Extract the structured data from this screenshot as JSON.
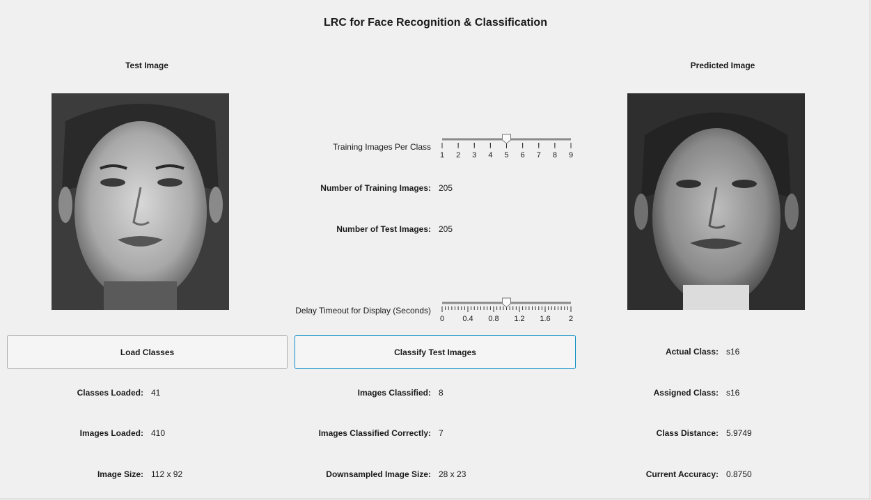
{
  "title": "LRC for Face Recognition & Classification",
  "test_panel": {
    "title": "Test Image"
  },
  "predicted_panel": {
    "title": "Predicted Image"
  },
  "sliders": {
    "training": {
      "label": "Training Images Per Class",
      "value": 5,
      "min": 1,
      "max": 9,
      "ticks": [
        "1",
        "2",
        "3",
        "4",
        "5",
        "6",
        "7",
        "8",
        "9"
      ]
    },
    "delay": {
      "label": "Delay Timeout for Display (Seconds)",
      "value": 1.0,
      "min": 0,
      "max": 2,
      "ticks": [
        "0",
        "0.4",
        "0.8",
        "1.2",
        "1.6",
        "2"
      ]
    }
  },
  "info": {
    "training_images": {
      "label": "Number of Training Images:",
      "value": "205"
    },
    "test_images": {
      "label": "Number of Test Images:",
      "value": "205"
    }
  },
  "buttons": {
    "load": "Load Classes",
    "classify": "Classify Test Images"
  },
  "left_stats": {
    "classes_loaded": {
      "label": "Classes Loaded:",
      "value": "41"
    },
    "images_loaded": {
      "label": "Images Loaded:",
      "value": "410"
    },
    "image_size": {
      "label": "Image Size:",
      "value": "112 x 92"
    }
  },
  "mid_stats": {
    "images_classified": {
      "label": "Images Classified:",
      "value": "8"
    },
    "classified_correctly": {
      "label": "Images Classified Correctly:",
      "value": "7"
    },
    "downsampled_size": {
      "label": "Downsampled Image Size:",
      "value": "28 x 23"
    }
  },
  "right_stats": {
    "actual_class": {
      "label": "Actual Class:",
      "value": "s16"
    },
    "assigned_class": {
      "label": "Assigned Class:",
      "value": "s16"
    },
    "class_distance": {
      "label": "Class Distance:",
      "value": "5.9749"
    },
    "current_accuracy": {
      "label": "Current Accuracy:",
      "value": "0.8750"
    }
  }
}
